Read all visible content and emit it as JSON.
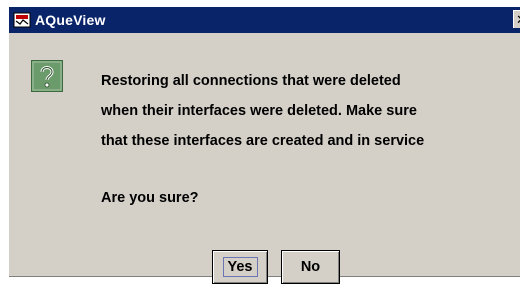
{
  "window": {
    "title": "AQueView",
    "close_glyph": "✕"
  },
  "icons": {
    "app": "app-logo-icon",
    "question": "question-icon",
    "question_color": "#6b9a6b"
  },
  "dialog": {
    "message_lines": [
      "Restoring all connections that were deleted",
      "when their interfaces were deleted.  Make sure",
      "that these interfaces are created and in service"
    ],
    "confirm": "Are you sure?"
  },
  "buttons": {
    "yes_label": "Yes",
    "no_label": "No"
  }
}
